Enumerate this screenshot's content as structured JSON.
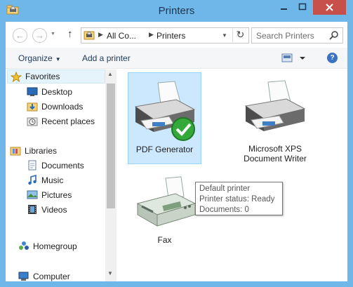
{
  "window": {
    "title": "Printers",
    "accent": "#6fb6e9",
    "close_color": "#c7504a"
  },
  "address": {
    "crumbs": [
      "All Co...",
      "Printers"
    ],
    "search_placeholder": "Search Printers"
  },
  "command_bar": {
    "organize_label": "Organize",
    "add_printer_label": "Add a printer"
  },
  "nav_pane": {
    "items": [
      {
        "label": "Favorites",
        "icon": "star-icon"
      },
      {
        "label": "Desktop",
        "icon": "desktop-icon"
      },
      {
        "label": "Downloads",
        "icon": "downloads-icon"
      },
      {
        "label": "Recent places",
        "icon": "recent-places-icon"
      },
      {
        "label": "Libraries",
        "icon": "libraries-icon"
      },
      {
        "label": "Documents",
        "icon": "documents-icon"
      },
      {
        "label": "Music",
        "icon": "music-icon"
      },
      {
        "label": "Pictures",
        "icon": "pictures-icon"
      },
      {
        "label": "Videos",
        "icon": "videos-icon"
      },
      {
        "label": "Homegroup",
        "icon": "homegroup-icon"
      },
      {
        "label": "Computer",
        "icon": "computer-icon"
      }
    ]
  },
  "devices": [
    {
      "name": "PDF Generator",
      "selected": true,
      "default": true
    },
    {
      "name": "Microsoft XPS Document Writer",
      "selected": false
    },
    {
      "name": "Fax",
      "selected": false
    }
  ],
  "tooltip": {
    "line1": "Default printer",
    "line2": "Printer status: Ready",
    "line3": "Documents: 0"
  }
}
